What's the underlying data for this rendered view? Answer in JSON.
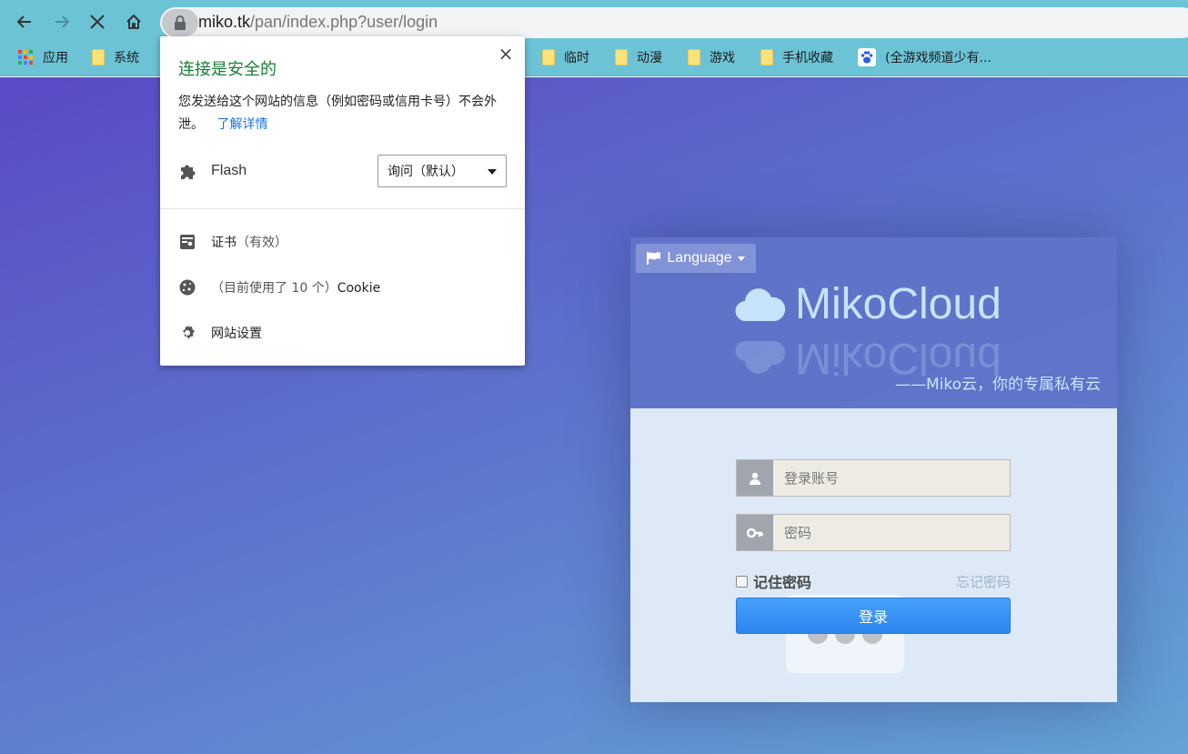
{
  "browser": {
    "url_host": "miko.tk",
    "url_path": "/pan/index.php?user/login"
  },
  "bookmarks": [
    {
      "label": "应用",
      "icon": "apps-grid-icon"
    },
    {
      "label": "系统",
      "icon": "folder-icon"
    },
    {
      "label": "临时",
      "icon": "folder-icon"
    },
    {
      "label": "动漫",
      "icon": "folder-icon"
    },
    {
      "label": "游戏",
      "icon": "folder-icon"
    },
    {
      "label": "手机收藏",
      "icon": "folder-icon"
    },
    {
      "label": "(全游戏频道少有...",
      "icon": "baidu-paw-icon"
    }
  ],
  "popup": {
    "title": "连接是安全的",
    "description": "您发送给这个网站的信息（例如密码或信用卡号）不会外泄。",
    "learn_more": "了解详情",
    "flash_label": "Flash",
    "flash_select": "询问（默认）",
    "certificate": "证书",
    "certificate_status": "（有效）",
    "cookie_count": "（目前使用了 10 个）",
    "cookie_label": "Cookie",
    "site_settings": "网站设置",
    "close": "×"
  },
  "login": {
    "language_button": "Language",
    "brand": "MikoCloud",
    "slogan": "——Miko云，你的专属私有云",
    "username_placeholder": "登录账号",
    "password_placeholder": "密码",
    "remember": "记住密码",
    "forgot": "忘记密码",
    "submit": "登录"
  },
  "colors": {
    "popup_title": "#188038",
    "link": "#1a73e8",
    "login_button": "#2c86f0",
    "toolbar": "#6cc3d6"
  }
}
